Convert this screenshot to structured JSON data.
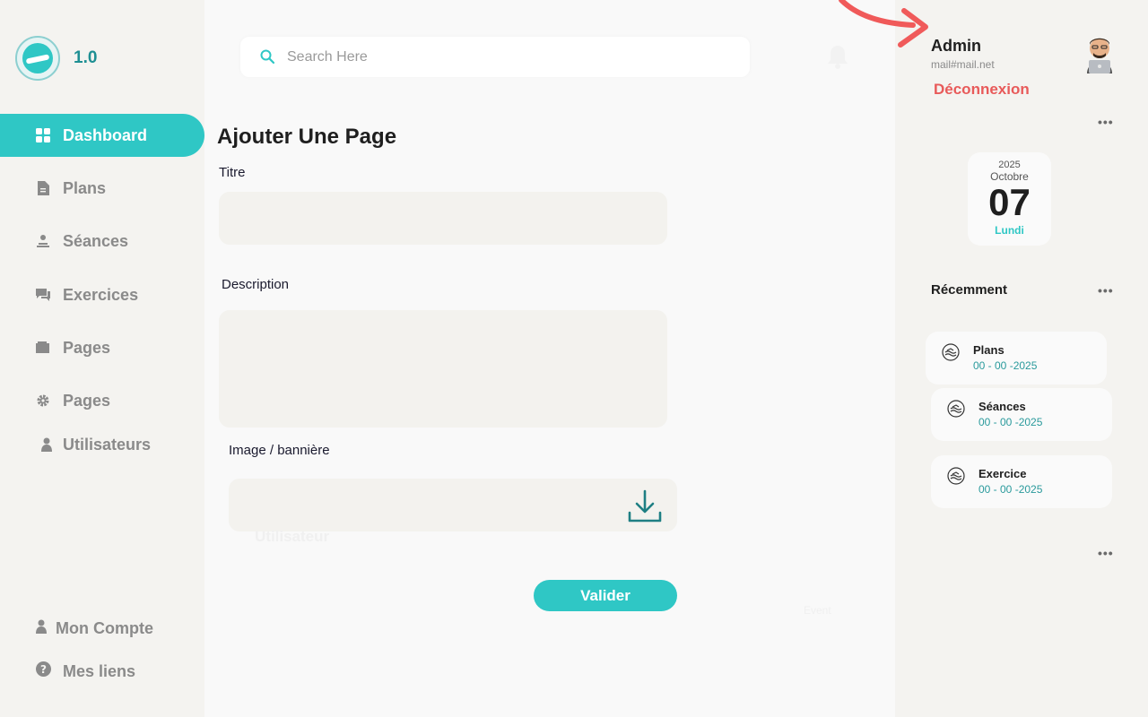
{
  "app": {
    "version": "1.0"
  },
  "colors": {
    "accent": "#2fc7c5",
    "danger": "#e85a5a",
    "sidebar_bg": "#f4f3f0"
  },
  "sidebar": {
    "items": [
      {
        "label": "Dashboard",
        "icon": "grid-icon",
        "active": true
      },
      {
        "label": "Plans",
        "icon": "document-icon"
      },
      {
        "label": "Séances",
        "icon": "person-desk-icon"
      },
      {
        "label": "Exercices",
        "icon": "chat-icon"
      },
      {
        "label": "Pages",
        "icon": "folder-icon"
      },
      {
        "label": "Pages",
        "icon": "gear-icon"
      },
      {
        "label": "Utilisateurs",
        "icon": "user-icon"
      }
    ],
    "bottom": [
      {
        "label": "Mon Compte",
        "icon": "user-icon"
      },
      {
        "label": "Mes liens",
        "icon": "help-icon"
      }
    ]
  },
  "search": {
    "placeholder": "Search Here"
  },
  "form": {
    "title": "Ajouter Une Page",
    "titre_label": "Titre",
    "description_label": "Description",
    "image_label": "Image / bannière",
    "ghost_user": "Utilisateur",
    "ghost_event": "Event",
    "submit_label": "Valider"
  },
  "user": {
    "name": "Admin",
    "email": "mail#mail.net",
    "logout": "Déconnexion"
  },
  "calendar": {
    "year": "2025",
    "month": "Octobre",
    "day": "07",
    "weekday": "Lundi"
  },
  "recent": {
    "title": "Récemment",
    "items": [
      {
        "title": "Plans",
        "date": "00 - 00 -2025"
      },
      {
        "title": "Séances",
        "date": "00 - 00 -2025"
      },
      {
        "title": "Exercice",
        "date": "00 - 00 -2025"
      }
    ]
  }
}
